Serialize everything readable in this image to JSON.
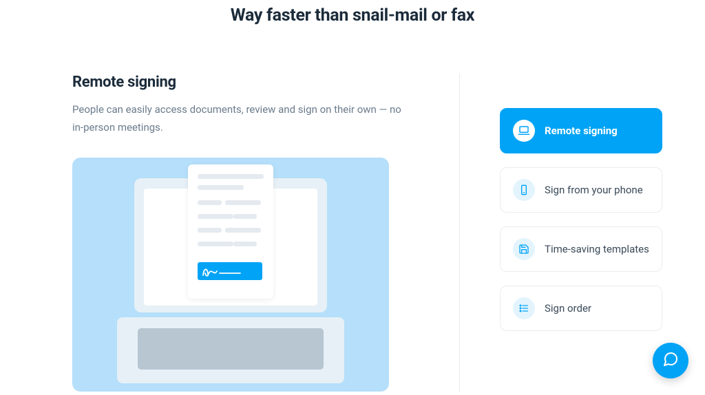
{
  "heading": "Way faster than snail-mail or fax",
  "feature": {
    "title": "Remote signing",
    "description": "People can easily access documents, review and sign on their own — no in-person meetings."
  },
  "options": [
    {
      "label": "Remote signing",
      "icon": "laptop",
      "active": true
    },
    {
      "label": "Sign from your phone",
      "icon": "phone",
      "active": false
    },
    {
      "label": "Time-saving templates",
      "icon": "save",
      "active": false
    },
    {
      "label": "Sign order",
      "icon": "list",
      "active": false
    }
  ],
  "chat_fab": {
    "icon": "chat"
  }
}
